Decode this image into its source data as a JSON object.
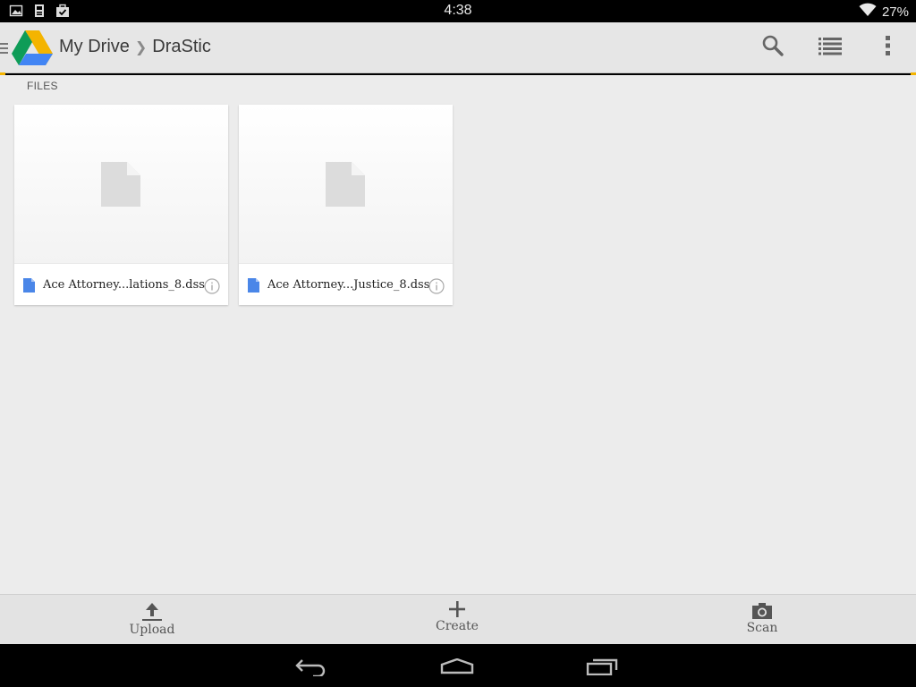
{
  "status_bar": {
    "time": "4:38",
    "battery": "27%",
    "notification_icons": [
      "picture-icon",
      "sd-card-icon",
      "briefcase-check-icon"
    ]
  },
  "action_bar": {
    "breadcrumb": [
      "My Drive",
      "DraStic"
    ],
    "separator": "❯",
    "actions": [
      "search-icon",
      "list-view-icon",
      "overflow-menu-icon"
    ]
  },
  "content": {
    "section_label": "FILES",
    "files": [
      {
        "name": "Ace Attorney...lations_8.dss"
      },
      {
        "name": "Ace Attorney...Justice_8.dss"
      }
    ]
  },
  "bottom_bar": {
    "upload_label": "Upload",
    "create_label": "Create",
    "scan_label": "Scan"
  },
  "nav_bar": {
    "buttons": [
      "back-icon",
      "home-icon",
      "recents-icon"
    ]
  },
  "colors": {
    "drive_yellow": "#f4b400",
    "drive_green": "#0f9d58",
    "drive_blue": "#4285f4",
    "file_icon_blue": "#4a86e8"
  }
}
